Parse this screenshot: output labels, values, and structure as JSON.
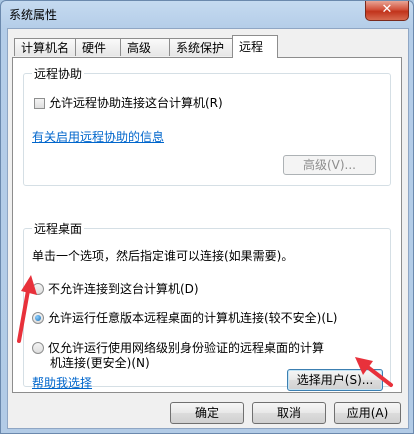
{
  "window": {
    "title": "系统属性",
    "close_glyph": "✕"
  },
  "tabs": [
    {
      "label": "计算机名"
    },
    {
      "label": "硬件"
    },
    {
      "label": "高级"
    },
    {
      "label": "系统保护"
    },
    {
      "label": "远程"
    }
  ],
  "remote_assistance": {
    "group_title": "远程协助",
    "allow_checkbox_label": "允许远程协助连接这台计算机(R)",
    "allow_checked": false,
    "info_link": "有关启用远程协助的信息",
    "advanced_button": "高级(V)..."
  },
  "remote_desktop": {
    "group_title": "远程桌面",
    "instruction": "单击一个选项，然后指定谁可以连接(如果需要)。",
    "options": [
      {
        "label": "不允许连接到这台计算机(D)",
        "checked": false
      },
      {
        "label": "允许运行任意版本远程桌面的计算机连接(较不安全)(L)",
        "checked": true
      },
      {
        "label_line1": "仅允许运行使用网络级别身份验证的远程桌面的计算",
        "label_line2": "机连接(更安全)(N)",
        "checked": false
      }
    ],
    "help_link": "帮助我选择",
    "select_users_button": "选择用户(S)..."
  },
  "footer": {
    "ok_button": "确定",
    "cancel_button": "取消",
    "apply_button": "应用(A)"
  },
  "colors": {
    "arrow": "#e8313b",
    "link": "#0066cc"
  }
}
